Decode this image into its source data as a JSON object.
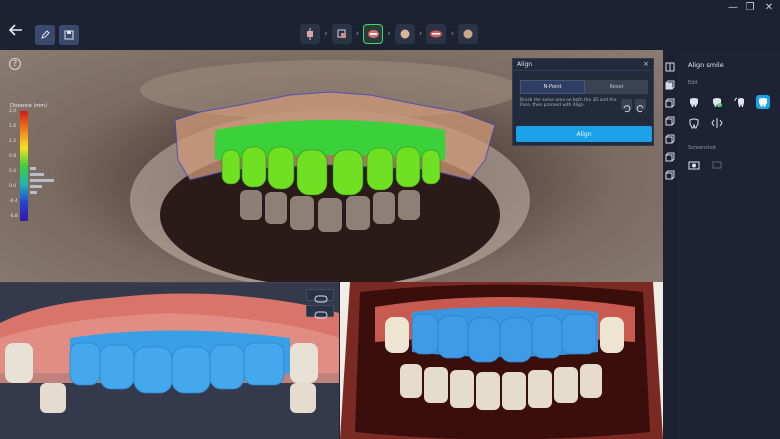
{
  "toolbar": {
    "back_icon": "arrow-left-icon",
    "buttons": [
      {
        "name": "edit-icon"
      },
      {
        "name": "save-icon"
      }
    ]
  },
  "window_controls": {
    "minimize": "—",
    "restore": "❐",
    "close": "✕"
  },
  "steps": [
    {
      "name": "step-scan-icon",
      "active": false
    },
    {
      "name": "step-models-icon",
      "active": false
    },
    {
      "name": "step-smile-icon",
      "active": true
    },
    {
      "name": "step-face-icon",
      "active": false
    },
    {
      "name": "step-lips-icon",
      "active": false
    },
    {
      "name": "step-profile-icon",
      "active": false
    }
  ],
  "main_view": {
    "help": "?",
    "legend": {
      "title": "Distance (mm)",
      "ticks": [
        "2.0",
        "1.6",
        "1.2",
        "0.8",
        "0.4",
        "0.0",
        "-0.4",
        "-0.8"
      ]
    }
  },
  "align_panel": {
    "title": "Align",
    "close": "×",
    "tabs": [
      "N-Point",
      "Reset"
    ],
    "description": "Brush the same area on both the 3D and the Face, then proceed with Align.",
    "align_label": "Align"
  },
  "right_panel": {
    "title": "Align smile",
    "section_edit": "Edit",
    "section_screenshot": "Screenshot"
  },
  "colors": {
    "accent": "#1aa3e8",
    "active_step": "#3ddc6a",
    "background": "#1e2433"
  }
}
